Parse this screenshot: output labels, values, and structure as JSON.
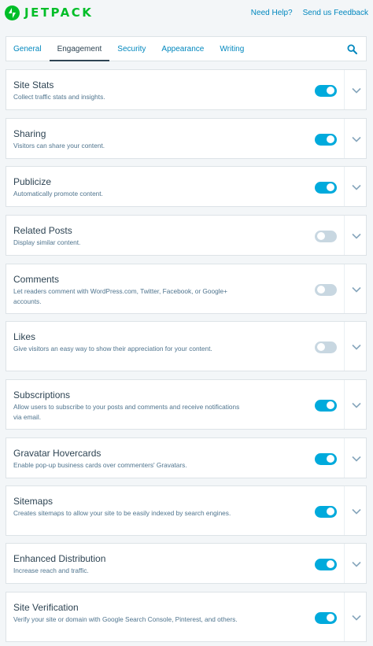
{
  "app": {
    "logo_text": "JETPACK"
  },
  "header": {
    "help_link": "Need Help?",
    "feedback_link": "Send us Feedback"
  },
  "tabs": [
    {
      "label": "General",
      "active": false
    },
    {
      "label": "Engagement",
      "active": true
    },
    {
      "label": "Security",
      "active": false
    },
    {
      "label": "Appearance",
      "active": false
    },
    {
      "label": "Writing",
      "active": false
    }
  ],
  "icons": {
    "search": "search-icon",
    "expand": "chevron-down-icon",
    "logo": "jetpack-bolt-icon"
  },
  "colors": {
    "brand": "#00be28",
    "link": "#0087be",
    "toggle_on": "#00aadc",
    "toggle_off": "#c8d7e1"
  },
  "modules": [
    {
      "title": "Site Stats",
      "description": "Collect traffic stats and insights.",
      "enabled": true
    },
    {
      "title": "Sharing",
      "description": "Visitors can share your content.",
      "enabled": true
    },
    {
      "title": "Publicize",
      "description": "Automatically promote content.",
      "enabled": true
    },
    {
      "title": "Related Posts",
      "description": "Display similar content.",
      "enabled": false
    },
    {
      "title": "Comments",
      "description": "Let readers comment with WordPress.com, Twitter, Facebook, or Google+ accounts.",
      "enabled": false
    },
    {
      "title": "Likes",
      "description": "Give visitors an easy way to show their appreciation for your content.",
      "enabled": false
    },
    {
      "title": "Subscriptions",
      "description": "Allow users to subscribe to your posts and comments and receive notifications via email.",
      "enabled": true
    },
    {
      "title": "Gravatar Hovercards",
      "description": "Enable pop-up business cards over commenters' Gravatars.",
      "enabled": true
    },
    {
      "title": "Sitemaps",
      "description": "Creates sitemaps to allow your site to be easily indexed by search engines.",
      "enabled": true
    },
    {
      "title": "Enhanced Distribution",
      "description": "Increase reach and traffic.",
      "enabled": true
    },
    {
      "title": "Site Verification",
      "description": "Verify your site or domain with Google Search Console, Pinterest, and others.",
      "enabled": true
    }
  ]
}
